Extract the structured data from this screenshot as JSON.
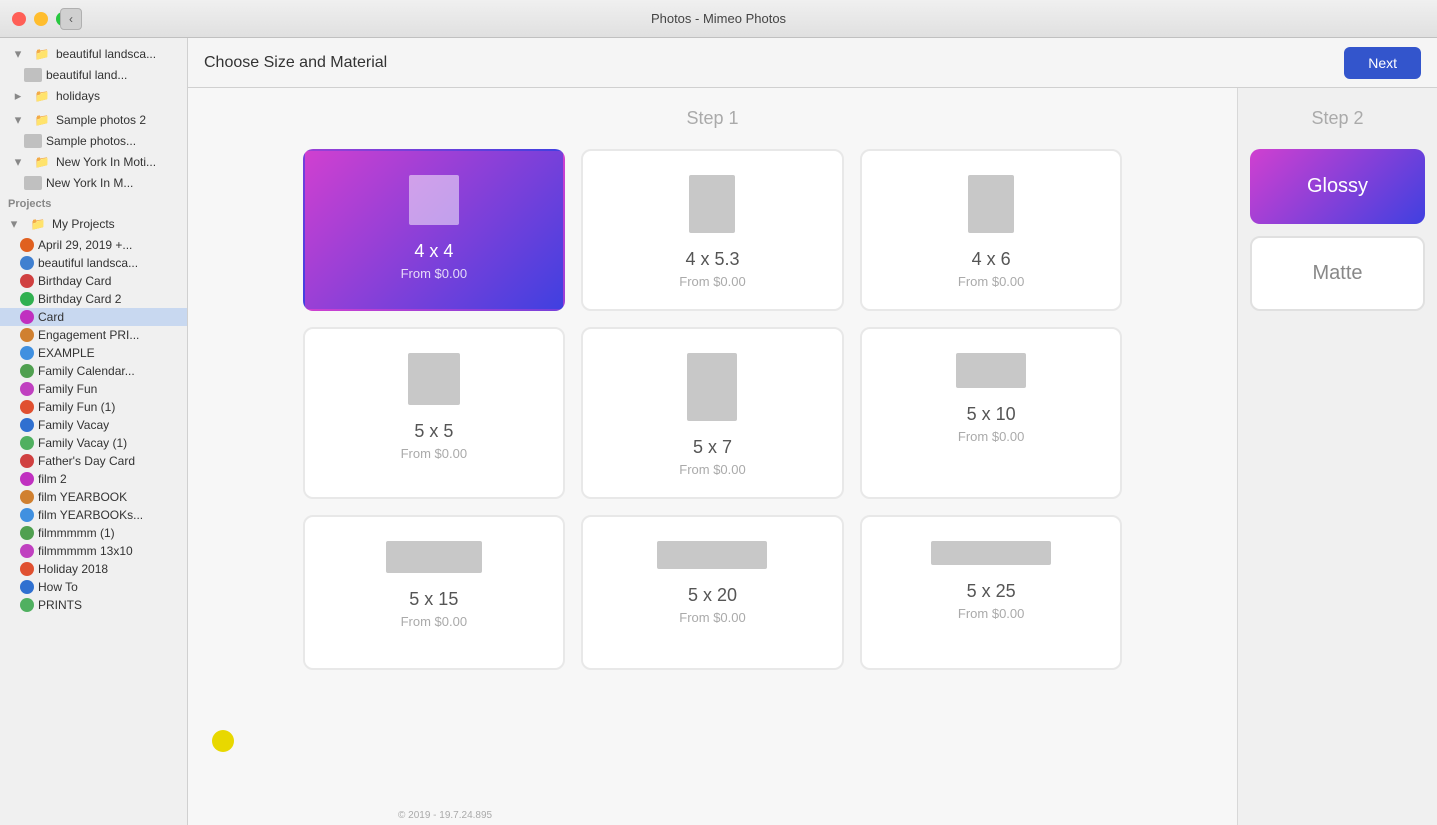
{
  "titlebar": {
    "title": "Photos - Mimeo Photos",
    "back_icon": "‹"
  },
  "header": {
    "title": "Choose Size and Material",
    "next_label": "Next"
  },
  "step1": {
    "label": "Step 1",
    "sizes": [
      {
        "id": "4x4",
        "name": "4 x 4",
        "price": "From $0.00",
        "selected": true,
        "preview_w": 50,
        "preview_h": 50,
        "landscape": false
      },
      {
        "id": "4x5.3",
        "name": "4 x 5.3",
        "price": "From $0.00",
        "selected": false,
        "preview_w": 50,
        "preview_h": 64,
        "landscape": false
      },
      {
        "id": "4x6",
        "name": "4 x 6",
        "price": "From $0.00",
        "selected": false,
        "preview_w": 50,
        "preview_h": 75,
        "landscape": false
      },
      {
        "id": "5x5",
        "name": "5 x 5",
        "price": "From $0.00",
        "selected": false,
        "preview_w": 55,
        "preview_h": 55,
        "landscape": false
      },
      {
        "id": "5x7",
        "name": "5 x 7",
        "price": "From $0.00",
        "selected": false,
        "preview_w": 55,
        "preview_h": 70,
        "landscape": false
      },
      {
        "id": "5x10",
        "name": "5 x 10",
        "price": "From $0.00",
        "selected": false,
        "preview_w": 65,
        "preview_h": 42,
        "landscape": false
      },
      {
        "id": "5x15",
        "name": "5 x 15",
        "price": "From $0.00",
        "selected": false,
        "preview_w": 90,
        "preview_h": 30,
        "landscape": true
      },
      {
        "id": "5x20",
        "name": "5 x 20",
        "price": "From $0.00",
        "selected": false,
        "preview_w": 110,
        "preview_h": 28,
        "landscape": true
      },
      {
        "id": "5x25",
        "name": "5 x 25",
        "price": "From $0.00",
        "selected": false,
        "preview_w": 120,
        "preview_h": 24,
        "landscape": true
      }
    ]
  },
  "step2": {
    "label": "Step 2",
    "materials": [
      {
        "id": "glossy",
        "label": "Glossy",
        "selected": true
      },
      {
        "id": "matte",
        "label": "Matte",
        "selected": false
      }
    ]
  },
  "sidebar": {
    "folders": [
      {
        "label": "beautiful landsca...",
        "depth": 1,
        "type": "folder"
      },
      {
        "label": "beautiful land...",
        "depth": 2,
        "type": "item"
      },
      {
        "label": "holidays",
        "depth": 1,
        "type": "folder"
      },
      {
        "label": "Sample photos 2",
        "depth": 1,
        "type": "folder"
      },
      {
        "label": "Sample photos...",
        "depth": 2,
        "type": "item"
      },
      {
        "label": "New York In Moti...",
        "depth": 1,
        "type": "folder"
      },
      {
        "label": "New York In M...",
        "depth": 2,
        "type": "item"
      }
    ],
    "projects_header": "Projects",
    "projects": [
      {
        "label": "My Projects",
        "type": "folder",
        "depth": 0
      },
      {
        "label": "April 29, 2019 +...",
        "color": "#e06020",
        "depth": 1
      },
      {
        "label": "beautiful landsca...",
        "color": "#4080d0",
        "depth": 1
      },
      {
        "label": "Birthday Card",
        "color": "#d04040",
        "depth": 1
      },
      {
        "label": "Birthday Card 2",
        "color": "#30b050",
        "depth": 1
      },
      {
        "label": "Card",
        "color": "#c030c0",
        "depth": 1,
        "selected": true
      },
      {
        "label": "Engagement PRI...",
        "color": "#d08030",
        "depth": 1
      },
      {
        "label": "EXAMPLE",
        "color": "#4090e0",
        "depth": 1
      },
      {
        "label": "Family Calendar...",
        "color": "#50a050",
        "depth": 1
      },
      {
        "label": "Family Fun",
        "color": "#c040c0",
        "depth": 1
      },
      {
        "label": "Family Fun (1)",
        "color": "#e05030",
        "depth": 1
      },
      {
        "label": "Family Vacay",
        "color": "#3070d0",
        "depth": 1
      },
      {
        "label": "Family Vacay (1)",
        "color": "#50b060",
        "depth": 1
      },
      {
        "label": "Father's Day Card",
        "color": "#d04040",
        "depth": 1
      },
      {
        "label": "film 2",
        "color": "#c030c0",
        "depth": 1
      },
      {
        "label": "film YEARBOOK",
        "color": "#d08030",
        "depth": 1
      },
      {
        "label": "film YEARBOOKs...",
        "color": "#4090e0",
        "depth": 1
      },
      {
        "label": "filmmmmm (1)",
        "color": "#50a050",
        "depth": 1
      },
      {
        "label": "filmmmmm 13x10",
        "color": "#c040c0",
        "depth": 1
      },
      {
        "label": "Holiday 2018",
        "color": "#e05030",
        "depth": 1
      },
      {
        "label": "How To",
        "color": "#3070d0",
        "depth": 1
      },
      {
        "label": "PRINTS",
        "color": "#50b060",
        "depth": 1
      }
    ]
  },
  "footer": {
    "text": "© 2019 - 19.7.24.895"
  }
}
